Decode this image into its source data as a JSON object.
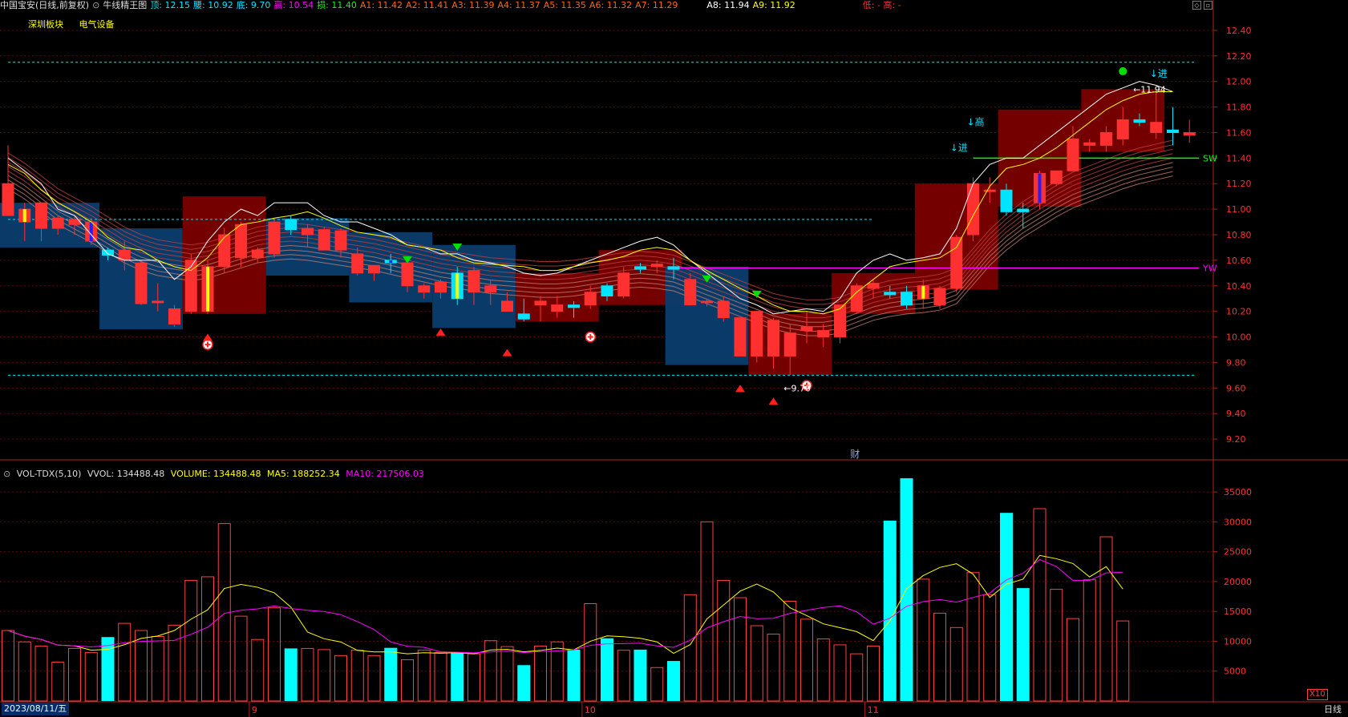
{
  "header": {
    "stock": "中国宝安(日线,前复权)",
    "indicator": "牛线精王图",
    "fields": [
      {
        "label": "顶:",
        "value": "12.15",
        "color": "#00e5ff"
      },
      {
        "label": "腰:",
        "value": "10.92",
        "color": "#00e5ff"
      },
      {
        "label": "底:",
        "value": "9.70",
        "color": "#00e5ff"
      },
      {
        "label": "赢:",
        "value": "10.54",
        "color": "#ff00ff"
      },
      {
        "label": "损:",
        "value": "11.40",
        "color": "#00ff00"
      },
      {
        "label": "A1:",
        "value": "11.42",
        "color": "#ff6600"
      },
      {
        "label": "A2:",
        "value": "11.41",
        "color": "#ff6600"
      },
      {
        "label": "A3:",
        "value": "11.39",
        "color": "#ff6600"
      },
      {
        "label": "A4:",
        "value": "11.37",
        "color": "#ff6600"
      },
      {
        "label": "A5:",
        "value": "11.35",
        "color": "#ff6600"
      },
      {
        "label": "A6:",
        "value": "11.32",
        "color": "#ff6600"
      },
      {
        "label": "A7:",
        "value": "11.29",
        "color": "#ff6600"
      },
      {
        "label": "A8:",
        "value": "11.94",
        "color": "#ffffff"
      },
      {
        "label": "A9:",
        "value": "11.92",
        "color": "#ffff00"
      }
    ],
    "extra": "低: - 高: -",
    "sector_tags": [
      "深圳板块",
      "电气设备"
    ]
  },
  "volume_header": {
    "name": "VOL-TDX(5,10)",
    "vvol": "VVOL: 134488.48",
    "volume": "VOLUME: 134488.48",
    "ma5": "MA5: 188252.34",
    "ma10": "MA10: 217506.03"
  },
  "footer": {
    "date": "2023/08/11/五",
    "period": "日线",
    "vol_unit": "X10"
  },
  "chart_data": [
    {
      "type": "candlestick",
      "y_ticks": [
        12.4,
        12.2,
        12.0,
        11.8,
        11.6,
        11.4,
        11.2,
        11.0,
        10.8,
        10.6,
        10.4,
        10.2,
        10.0,
        9.8,
        9.6,
        9.4,
        9.2
      ],
      "ylim": [
        9.05,
        12.55
      ],
      "x_month_labels": [
        {
          "label": "9",
          "index": 15
        },
        {
          "label": "10",
          "index": 35
        },
        {
          "label": "11",
          "index": 52
        }
      ],
      "candles": [
        {
          "o": 10.95,
          "h": 11.5,
          "l": 10.95,
          "c": 11.2
        },
        {
          "o": 10.9,
          "h": 11.05,
          "l": 10.75,
          "c": 11.0
        },
        {
          "o": 10.85,
          "h": 11.05,
          "l": 10.75,
          "c": 11.05
        },
        {
          "o": 10.85,
          "h": 10.95,
          "l": 10.8,
          "c": 10.93
        },
        {
          "o": 10.88,
          "h": 10.95,
          "l": 10.8,
          "c": 10.92
        },
        {
          "o": 10.75,
          "h": 10.93,
          "l": 10.72,
          "c": 10.9
        },
        {
          "o": 10.68,
          "h": 10.7,
          "l": 10.6,
          "c": 10.64
        },
        {
          "o": 10.6,
          "h": 10.75,
          "l": 10.52,
          "c": 10.68
        },
        {
          "o": 10.26,
          "h": 10.6,
          "l": 10.25,
          "c": 10.58
        },
        {
          "o": 10.27,
          "h": 10.42,
          "l": 10.2,
          "c": 10.28
        },
        {
          "o": 10.1,
          "h": 10.25,
          "l": 10.08,
          "c": 10.22
        },
        {
          "o": 10.2,
          "h": 10.65,
          "l": 10.18,
          "c": 10.6
        },
        {
          "o": 10.2,
          "h": 10.6,
          "l": 10.18,
          "c": 10.55
        },
        {
          "o": 10.55,
          "h": 10.85,
          "l": 10.5,
          "c": 10.8
        },
        {
          "o": 10.62,
          "h": 10.9,
          "l": 10.55,
          "c": 10.88
        },
        {
          "o": 10.62,
          "h": 10.7,
          "l": 10.58,
          "c": 10.68
        },
        {
          "o": 10.65,
          "h": 10.92,
          "l": 10.62,
          "c": 10.9
        },
        {
          "o": 10.92,
          "h": 10.95,
          "l": 10.8,
          "c": 10.84
        },
        {
          "o": 10.8,
          "h": 10.88,
          "l": 10.7,
          "c": 10.85
        },
        {
          "o": 10.68,
          "h": 10.86,
          "l": 10.68,
          "c": 10.84
        },
        {
          "o": 10.68,
          "h": 10.85,
          "l": 10.62,
          "c": 10.83
        },
        {
          "o": 10.5,
          "h": 10.7,
          "l": 10.48,
          "c": 10.65
        },
        {
          "o": 10.5,
          "h": 10.55,
          "l": 10.44,
          "c": 10.56
        },
        {
          "o": 10.6,
          "h": 10.65,
          "l": 10.5,
          "c": 10.58
        },
        {
          "o": 10.4,
          "h": 10.6,
          "l": 10.35,
          "c": 10.58
        },
        {
          "o": 10.35,
          "h": 10.42,
          "l": 10.3,
          "c": 10.4
        },
        {
          "o": 10.35,
          "h": 10.45,
          "l": 10.3,
          "c": 10.43
        },
        {
          "o": 10.5,
          "h": 10.55,
          "l": 10.25,
          "c": 10.3
        },
        {
          "o": 10.35,
          "h": 10.55,
          "l": 10.25,
          "c": 10.52
        },
        {
          "o": 10.35,
          "h": 10.45,
          "l": 10.25,
          "c": 10.4
        },
        {
          "o": 10.2,
          "h": 10.35,
          "l": 10.2,
          "c": 10.28
        },
        {
          "o": 10.18,
          "h": 10.3,
          "l": 10.12,
          "c": 10.14
        },
        {
          "o": 10.25,
          "h": 10.32,
          "l": 10.12,
          "c": 10.28
        },
        {
          "o": 10.2,
          "h": 10.32,
          "l": 10.15,
          "c": 10.25
        },
        {
          "o": 10.25,
          "h": 10.28,
          "l": 10.15,
          "c": 10.23
        },
        {
          "o": 10.25,
          "h": 10.4,
          "l": 10.22,
          "c": 10.35
        },
        {
          "o": 10.4,
          "h": 10.42,
          "l": 10.28,
          "c": 10.32
        },
        {
          "o": 10.32,
          "h": 10.55,
          "l": 10.3,
          "c": 10.5
        },
        {
          "o": 10.55,
          "h": 10.58,
          "l": 10.5,
          "c": 10.53
        },
        {
          "o": 10.55,
          "h": 10.6,
          "l": 10.5,
          "c": 10.57
        },
        {
          "o": 10.55,
          "h": 10.62,
          "l": 10.45,
          "c": 10.53
        },
        {
          "o": 10.25,
          "h": 10.5,
          "l": 10.25,
          "c": 10.45
        },
        {
          "o": 10.27,
          "h": 10.3,
          "l": 10.24,
          "c": 10.28
        },
        {
          "o": 10.15,
          "h": 10.32,
          "l": 10.12,
          "c": 10.28
        },
        {
          "o": 9.85,
          "h": 10.15,
          "l": 9.85,
          "c": 10.15
        },
        {
          "o": 9.85,
          "h": 10.2,
          "l": 9.8,
          "c": 10.2
        },
        {
          "o": 9.85,
          "h": 10.15,
          "l": 9.75,
          "c": 10.13
        },
        {
          "o": 9.85,
          "h": 10.1,
          "l": 9.7,
          "c": 10.03
        },
        {
          "o": 10.05,
          "h": 10.2,
          "l": 9.95,
          "c": 10.08
        },
        {
          "o": 10.0,
          "h": 10.1,
          "l": 9.92,
          "c": 10.05
        },
        {
          "o": 10.0,
          "h": 10.25,
          "l": 9.95,
          "c": 10.25
        },
        {
          "o": 10.2,
          "h": 10.42,
          "l": 10.18,
          "c": 10.4
        },
        {
          "o": 10.38,
          "h": 10.45,
          "l": 10.3,
          "c": 10.42
        },
        {
          "o": 10.35,
          "h": 10.4,
          "l": 10.3,
          "c": 10.33
        },
        {
          "o": 10.35,
          "h": 10.4,
          "l": 10.22,
          "c": 10.25
        },
        {
          "o": 10.3,
          "h": 10.45,
          "l": 10.22,
          "c": 10.4
        },
        {
          "o": 10.25,
          "h": 10.4,
          "l": 10.22,
          "c": 10.38
        },
        {
          "o": 10.38,
          "h": 10.8,
          "l": 10.35,
          "c": 10.78
        },
        {
          "o": 10.8,
          "h": 11.25,
          "l": 10.75,
          "c": 11.2
        },
        {
          "o": 11.15,
          "h": 11.25,
          "l": 11.05,
          "c": 11.15
        },
        {
          "o": 11.15,
          "h": 11.2,
          "l": 10.95,
          "c": 10.98
        },
        {
          "o": 11.0,
          "h": 11.05,
          "l": 10.85,
          "c": 10.98
        },
        {
          "o": 11.05,
          "h": 11.3,
          "l": 11.0,
          "c": 11.28
        },
        {
          "o": 11.2,
          "h": 11.3,
          "l": 11.18,
          "c": 11.3
        },
        {
          "o": 11.3,
          "h": 11.65,
          "l": 11.3,
          "c": 11.55
        },
        {
          "o": 11.5,
          "h": 11.55,
          "l": 11.45,
          "c": 11.52
        },
        {
          "o": 11.5,
          "h": 11.65,
          "l": 11.45,
          "c": 11.6
        },
        {
          "o": 11.55,
          "h": 11.8,
          "l": 11.5,
          "c": 11.7
        },
        {
          "o": 11.7,
          "h": 11.75,
          "l": 11.65,
          "c": 11.68
        },
        {
          "o": 11.6,
          "h": 11.94,
          "l": 11.55,
          "c": 11.68
        },
        {
          "o": 11.62,
          "h": 11.8,
          "l": 11.5,
          "c": 11.6
        },
        {
          "o": 11.58,
          "h": 11.7,
          "l": 11.52,
          "c": 11.6
        }
      ],
      "bull_color": "#ff3030",
      "bear_color": "#00e5ff",
      "special_candles": {
        "yellow_body": [
          1,
          12,
          27,
          55
        ],
        "blue_body": [
          5,
          23,
          62
        ]
      },
      "boxes": [
        {
          "from": 0,
          "to": 5,
          "top": 11.05,
          "bottom": 10.7,
          "kind": "bear"
        },
        {
          "from": 6,
          "to": 10,
          "top": 10.85,
          "bottom": 10.06,
          "kind": "bear"
        },
        {
          "from": 11,
          "to": 15,
          "top": 11.1,
          "bottom": 10.18,
          "kind": "bull"
        },
        {
          "from": 16,
          "to": 20,
          "top": 10.93,
          "bottom": 10.48,
          "kind": "bear"
        },
        {
          "from": 21,
          "to": 25,
          "top": 10.82,
          "bottom": 10.27,
          "kind": "bear"
        },
        {
          "from": 26,
          "to": 30,
          "top": 10.72,
          "bottom": 10.07,
          "kind": "bear"
        },
        {
          "from": 31,
          "to": 35,
          "top": 10.5,
          "bottom": 10.12,
          "kind": "bull"
        },
        {
          "from": 36,
          "to": 40,
          "top": 10.68,
          "bottom": 10.25,
          "kind": "bull"
        },
        {
          "from": 40,
          "to": 44,
          "top": 10.55,
          "bottom": 9.78,
          "kind": "bear"
        },
        {
          "from": 45,
          "to": 49,
          "top": 10.18,
          "bottom": 9.7,
          "kind": "bull"
        },
        {
          "from": 50,
          "to": 54,
          "top": 10.5,
          "bottom": 10.18,
          "kind": "bull"
        },
        {
          "from": 55,
          "to": 59,
          "top": 11.2,
          "bottom": 10.37,
          "kind": "bull"
        },
        {
          "from": 60,
          "to": 64,
          "top": 11.78,
          "bottom": 11.02,
          "kind": "bull"
        },
        {
          "from": 65,
          "to": 69,
          "top": 11.94,
          "bottom": 11.45,
          "kind": "bull"
        }
      ],
      "price_labels": [
        {
          "text": "←9.70",
          "index": 47,
          "price": 9.6
        },
        {
          "text": "←11.94",
          "index": 68,
          "price": 11.94
        }
      ],
      "level_lines": [
        {
          "label": "SW",
          "price": 11.4,
          "from": 58,
          "color": "#00ff00"
        },
        {
          "label": "YW",
          "price": 10.54,
          "from": 40,
          "color": "#ff00ff"
        }
      ],
      "dashed_levels": [
        {
          "price": 12.15,
          "color": "#00e5ff"
        },
        {
          "price": 9.7,
          "color": "#00e5ff"
        },
        {
          "price": 10.92,
          "color": "#00e5ff",
          "to": 52
        }
      ],
      "text_signals": [
        {
          "text": "↓高",
          "index": 58,
          "price": 11.68,
          "color": "#00e5ff"
        },
        {
          "text": "↓进",
          "index": 57,
          "price": 11.48,
          "color": "#00e5ff"
        },
        {
          "text": "↓进",
          "index": 69,
          "price": 12.06,
          "color": "#00e5ff"
        },
        {
          "text": "财",
          "index": 51,
          "price": 9.08,
          "color": "#9ad"
        }
      ],
      "markers": [
        {
          "kind": "plus",
          "index": 12,
          "price": 9.94
        },
        {
          "kind": "up",
          "index": 12,
          "price": 10.0
        },
        {
          "kind": "up",
          "index": 26,
          "price": 10.04
        },
        {
          "kind": "up",
          "index": 30,
          "price": 9.88
        },
        {
          "kind": "plus",
          "index": 35,
          "price": 10.0
        },
        {
          "kind": "down",
          "index": 24,
          "price": 10.6
        },
        {
          "kind": "down",
          "index": 27,
          "price": 10.7
        },
        {
          "kind": "down",
          "index": 42,
          "price": 10.45
        },
        {
          "kind": "down",
          "index": 45,
          "price": 10.33
        },
        {
          "kind": "up",
          "index": 44,
          "price": 9.6
        },
        {
          "kind": "up",
          "index": 46,
          "price": 9.5
        },
        {
          "kind": "plus",
          "index": 48,
          "price": 9.62
        },
        {
          "kind": "dot",
          "index": 67,
          "price": 12.08
        }
      ],
      "line_a8": [
        11.4,
        11.3,
        11.2,
        11.0,
        10.95,
        10.8,
        10.65,
        10.6,
        10.6,
        10.6,
        10.45,
        10.55,
        10.75,
        10.9,
        11.0,
        10.95,
        11.05,
        11.05,
        11.05,
        10.95,
        10.9,
        10.9,
        10.85,
        10.8,
        10.72,
        10.7,
        10.65,
        10.65,
        10.6,
        10.58,
        10.55,
        10.5,
        10.48,
        10.5,
        10.55,
        10.6,
        10.65,
        10.7,
        10.75,
        10.78,
        10.72,
        10.6,
        10.5,
        10.4,
        10.3,
        10.25,
        10.18,
        10.2,
        10.22,
        10.2,
        10.3,
        10.5,
        10.6,
        10.65,
        10.6,
        10.62,
        10.65,
        10.85,
        11.2,
        11.35,
        11.4,
        11.4,
        11.5,
        11.6,
        11.7,
        11.8,
        11.9,
        11.95,
        12.0,
        11.97,
        11.92
      ],
      "line_a9": [
        11.35,
        11.28,
        11.15,
        11.05,
        10.98,
        10.9,
        10.78,
        10.7,
        10.68,
        10.6,
        10.55,
        10.52,
        10.62,
        10.78,
        10.88,
        10.9,
        10.93,
        10.95,
        10.98,
        10.93,
        10.87,
        10.82,
        10.8,
        10.78,
        10.72,
        10.7,
        10.68,
        10.62,
        10.58,
        10.57,
        10.56,
        10.55,
        10.52,
        10.52,
        10.55,
        10.58,
        10.6,
        10.63,
        10.68,
        10.7,
        10.68,
        10.6,
        10.52,
        10.45,
        10.38,
        10.32,
        10.25,
        10.2,
        10.2,
        10.18,
        10.22,
        10.35,
        10.45,
        10.55,
        10.58,
        10.6,
        10.62,
        10.7,
        10.95,
        11.18,
        11.32,
        11.35,
        11.4,
        11.48,
        11.58,
        11.68,
        11.78,
        11.85,
        11.9,
        11.92,
        11.92
      ],
      "ribbon_center": [
        11.3,
        11.22,
        11.12,
        11.02,
        10.95,
        10.88,
        10.8,
        10.72,
        10.66,
        10.62,
        10.6,
        10.58,
        10.6,
        10.64,
        10.68,
        10.72,
        10.74,
        10.75,
        10.74,
        10.72,
        10.7,
        10.68,
        10.66,
        10.63,
        10.6,
        10.57,
        10.54,
        10.52,
        10.5,
        10.48,
        10.47,
        10.46,
        10.45,
        10.45,
        10.46,
        10.48,
        10.5,
        10.52,
        10.53,
        10.52,
        10.5,
        10.45,
        10.4,
        10.35,
        10.3,
        10.25,
        10.2,
        10.17,
        10.15,
        10.15,
        10.17,
        10.22,
        10.27,
        10.3,
        10.32,
        10.33,
        10.35,
        10.4,
        10.55,
        10.7,
        10.82,
        10.92,
        11.0,
        11.08,
        11.15,
        11.2,
        11.25,
        11.3,
        11.34,
        11.37,
        11.4
      ]
    },
    {
      "type": "bar",
      "y_ticks": [
        35000,
        30000,
        25000,
        20000,
        15000,
        10000,
        5000
      ],
      "ylim": [
        0,
        38500
      ],
      "volumes": [
        11800,
        9900,
        9200,
        6500,
        8800,
        8100,
        10700,
        13000,
        11800,
        10800,
        12700,
        20200,
        20800,
        29700,
        14200,
        10300,
        15600,
        8800,
        8800,
        8600,
        7600,
        8500,
        7600,
        8900,
        6900,
        8500,
        8100,
        8100,
        7900,
        10100,
        9100,
        6000,
        9200,
        9900,
        8600,
        16300,
        10500,
        8500,
        8600,
        5600,
        6700,
        17800,
        30000,
        20200,
        17300,
        12600,
        11200,
        16700,
        13700,
        10400,
        9400,
        7900,
        9200,
        30200,
        37300,
        20400,
        14700,
        12300,
        21500,
        17800,
        31500,
        18900,
        32200,
        18700,
        13800,
        20300,
        27500,
        13400
      ]
    }
  ]
}
